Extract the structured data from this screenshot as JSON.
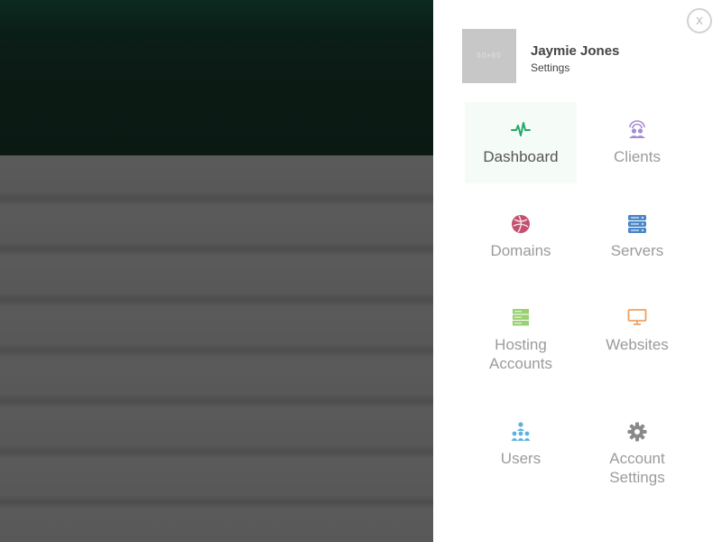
{
  "backdrop": {},
  "panel": {
    "close_label": "x",
    "profile": {
      "avatar_text": "60×60",
      "name": "Jaymie Jones",
      "subtitle": "Settings"
    },
    "menu": [
      {
        "label": "Dashboard",
        "icon": "dashboard-pulse-icon",
        "color": "#27a86a",
        "active": true
      },
      {
        "label": "Clients",
        "icon": "clients-icon",
        "color": "#a58bd6",
        "active": false
      },
      {
        "label": "Domains",
        "icon": "domains-globe-icon",
        "color": "#c4506f",
        "active": false
      },
      {
        "label": "Servers",
        "icon": "servers-icon",
        "color": "#4a86c8",
        "active": false
      },
      {
        "label": "Hosting Accounts",
        "icon": "hosting-accounts-icon",
        "color": "#9ad070",
        "active": false
      },
      {
        "label": "Websites",
        "icon": "websites-monitor-icon",
        "color": "#f0a060",
        "active": false
      },
      {
        "label": "Users",
        "icon": "users-icon",
        "color": "#5bb2e0",
        "active": false
      },
      {
        "label": "Account Settings",
        "icon": "account-settings-gear-icon",
        "color": "#8a8a8a",
        "active": false
      }
    ]
  }
}
